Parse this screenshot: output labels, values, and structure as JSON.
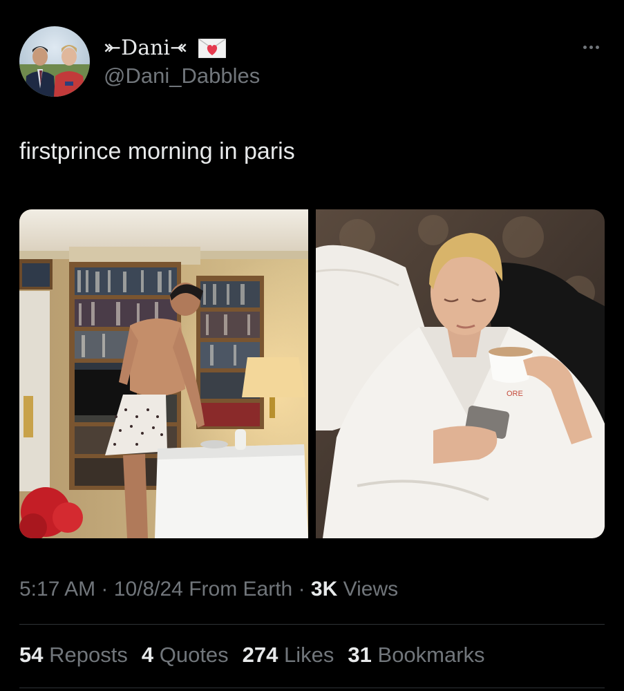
{
  "author": {
    "display_name": "⤜Dani⤛",
    "envelope_icon": "love-letter-icon",
    "handle": "@Dani_Dabbles"
  },
  "tweet": {
    "text": "firstprince morning in paris"
  },
  "media": [
    {
      "icon": "photo-man-cooking-in-library-room"
    },
    {
      "icon": "photo-man-in-bathrobe-with-coffee-and-phone"
    }
  ],
  "meta": {
    "time": "5:17 AM",
    "separator1": "·",
    "date": "10/8/24",
    "source": "From Earth",
    "separator2": "·",
    "views_count": "3K",
    "views_label": "Views"
  },
  "stats": {
    "reposts_count": "54",
    "reposts_label": "Reposts",
    "quotes_count": "4",
    "quotes_label": "Quotes",
    "likes_count": "274",
    "likes_label": "Likes",
    "bookmarks_count": "31",
    "bookmarks_label": "Bookmarks"
  },
  "colors": {
    "background": "#000000",
    "primary_text": "#e7e9ea",
    "secondary_text": "#71767b",
    "divider": "#2f3336"
  }
}
